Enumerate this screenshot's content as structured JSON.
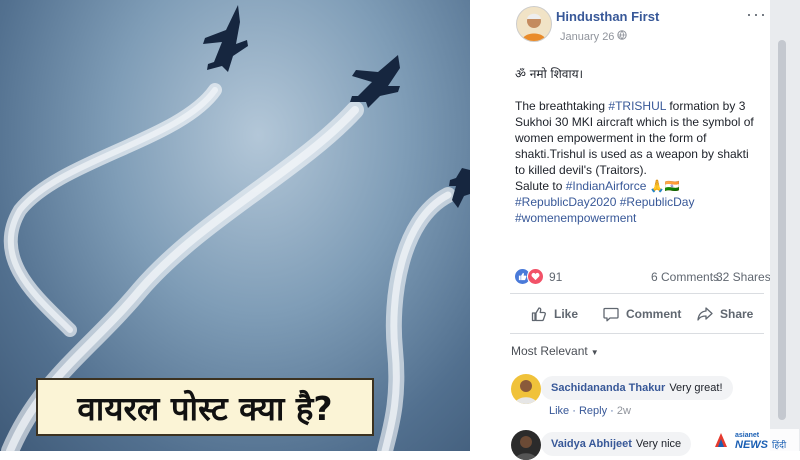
{
  "image_caption": "वायरल पोस्ट क्या है?",
  "post": {
    "page_name": "Hindusthan First",
    "time": "January 26 ·",
    "menu": "···",
    "invocation": "ॐ नमो शिवाय।",
    "text_prefix": "The breathtaking",
    "hashtag_trishul": "#TRISHUL",
    "text_main": "formation by 3 Sukhoi 30 MKI aircraft which is the symbol of women empowerment in the form of shakti.Trishul is used as a weapon by shakti to killed devil's (Traitors).",
    "salute_prefix": "Salute to",
    "hashtag_airforce": "#IndianAirforce",
    "salute_emoji": "🙏🇮🇳",
    "hashtags_line": "#RepublicDay2020 #RepublicDay",
    "hashtag_women": "#womenempowerment"
  },
  "stats": {
    "reaction_count": "91",
    "comments": "6 Comments",
    "shares": "32 Shares"
  },
  "actions": {
    "like": "Like",
    "comment": "Comment",
    "share": "Share"
  },
  "comments_filter": "Most Relevant",
  "comments": [
    {
      "author": "Sachidananda Thakur",
      "text": "Very great!",
      "like": "Like",
      "reply": "Reply",
      "age": "2w"
    },
    {
      "author": "Vaidya Abhijeet",
      "text": "Very nice"
    }
  ],
  "watermark": {
    "top": "asianet",
    "main": "NEWS",
    "lang": "हिंदी"
  },
  "colors": {
    "link": "#385898",
    "text": "#1d2129",
    "muted": "#606770",
    "like_reaction": "#4a7ad9",
    "love_reaction": "#f25268",
    "caption_bg": "#fbf4d6"
  },
  "icons": [
    "like-reaction-icon",
    "love-reaction-icon",
    "thumbs-up-icon",
    "comment-icon",
    "share-icon",
    "globe-icon",
    "more-options-icon",
    "caret-down-icon"
  ]
}
